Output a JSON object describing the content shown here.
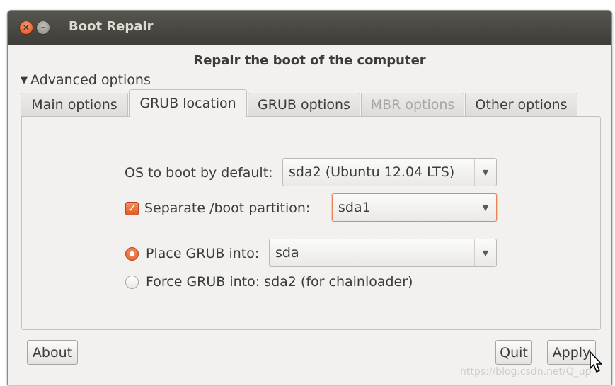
{
  "window": {
    "title": "Boot Repair",
    "heading": "Repair the boot of the computer"
  },
  "expander": {
    "label": "Advanced options",
    "expanded": true
  },
  "tabs": [
    {
      "label": "Main options",
      "state": "normal"
    },
    {
      "label": "GRUB location",
      "state": "active"
    },
    {
      "label": "GRUB options",
      "state": "normal"
    },
    {
      "label": "MBR options",
      "state": "disabled"
    },
    {
      "label": "Other options",
      "state": "normal"
    }
  ],
  "grub_location": {
    "os_label": "OS to boot by default:",
    "os_value": "sda2 (Ubuntu 12.04 LTS)",
    "separate_boot_label": "Separate /boot partition:",
    "separate_boot_checked": true,
    "separate_boot_value": "sda1",
    "place_grub_label": "Place GRUB into:",
    "place_grub_value": "sda",
    "place_grub_selected": true,
    "force_grub_label": "Force GRUB into: sda2 (for chainloader)",
    "force_grub_selected": false
  },
  "buttons": {
    "about": "About",
    "quit": "Quit",
    "apply": "Apply"
  },
  "watermark": "https://blog.csdn.net/Q_up",
  "colors": {
    "accent": "#e0561e",
    "titlebar": "#3e3d39",
    "window_bg": "#f2f1f0"
  }
}
